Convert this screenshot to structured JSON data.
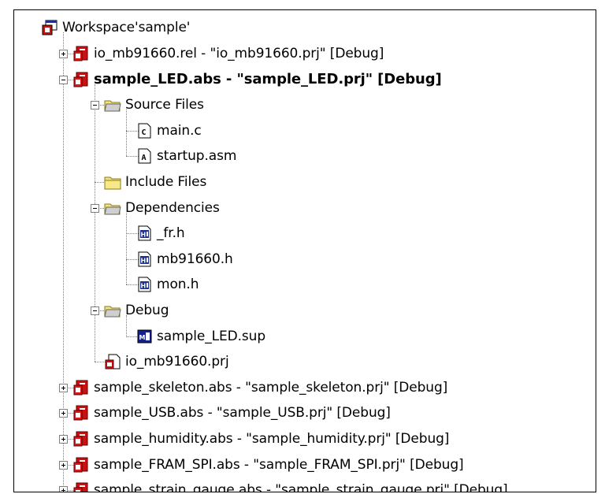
{
  "tree": {
    "workspace": {
      "label": "Workspace'sample'",
      "icon": "workspace-icon",
      "expanded": true
    },
    "projects": [
      {
        "label": "io_mb91660.rel - \"io_mb91660.prj\" [Debug]",
        "icon": "project-icon",
        "expanded": false
      },
      {
        "label": "sample_LED.abs - \"sample_LED.prj\" [Debug]",
        "icon": "project-icon",
        "expanded": true,
        "active": true,
        "children": [
          {
            "label": "Source Files",
            "icon": "open-folder-icon",
            "expanded": true,
            "children": [
              {
                "label": "main.c",
                "icon": "c-file-icon"
              },
              {
                "label": "startup.asm",
                "icon": "asm-file-icon"
              }
            ]
          },
          {
            "label": "Include Files",
            "icon": "folder-icon"
          },
          {
            "label": "Dependencies",
            "icon": "open-folder-icon",
            "expanded": true,
            "children": [
              {
                "label": "_fr.h",
                "icon": "header-file-icon"
              },
              {
                "label": "mb91660.h",
                "icon": "header-file-icon"
              },
              {
                "label": "mon.h",
                "icon": "header-file-icon"
              }
            ]
          },
          {
            "label": "Debug",
            "icon": "open-folder-icon",
            "expanded": true,
            "children": [
              {
                "label": "sample_LED.sup",
                "icon": "sup-file-icon"
              }
            ]
          },
          {
            "label": "io_mb91660.prj",
            "icon": "prj-file-icon"
          }
        ]
      },
      {
        "label": "sample_skeleton.abs - \"sample_skeleton.prj\" [Debug]",
        "icon": "project-icon",
        "expanded": false
      },
      {
        "label": "sample_USB.abs - \"sample_USB.prj\" [Debug]",
        "icon": "project-icon",
        "expanded": false
      },
      {
        "label": "sample_humidity.abs - \"sample_humidity.prj\" [Debug]",
        "icon": "project-icon",
        "expanded": false
      },
      {
        "label": "sample_FRAM_SPI.abs - \"sample_FRAM_SPI.prj\" [Debug]",
        "icon": "project-icon",
        "expanded": false
      },
      {
        "label": "sample_strain_gauge.abs - \"sample_strain_gauge.prj\" [Debug]",
        "icon": "project-icon",
        "expanded": false
      }
    ]
  },
  "colors": {
    "project_red": "#cc1010",
    "folder_yellow": "#f5e27a",
    "folder_teal": "#5f8fa0",
    "header_blue": "#1d2f8c",
    "sup_blue": "#14208c"
  }
}
